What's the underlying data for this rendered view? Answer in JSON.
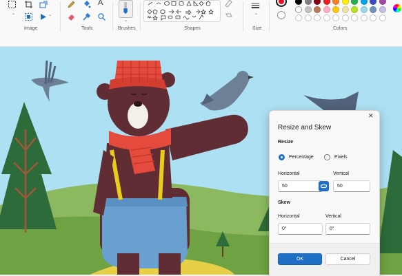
{
  "ribbon": {
    "groups": {
      "image": "Image",
      "tools": "Tools",
      "brushes": "Brushes",
      "shapes": "Shapes",
      "size": "Size",
      "colors": "Colors"
    },
    "tool_letter": "A",
    "palette_row1": [
      "#000000",
      "#7f7f7f",
      "#880015",
      "#ed1c24",
      "#ff7f27",
      "#fff200",
      "#22b14c",
      "#00a2e8",
      "#3f48cc",
      "#a349a4"
    ],
    "palette_row2": [
      "#ffffff",
      "#c3c3c3",
      "#b97a57",
      "#ffaec9",
      "#ffc90e",
      "#efe4b0",
      "#b5e61d",
      "#99d9ea",
      "#7092be",
      "#c8bfe7"
    ],
    "active_color": "#e81123"
  },
  "dialog": {
    "title": "Resize and Skew",
    "close_icon": "close-icon",
    "resize": {
      "heading": "Resize",
      "option_percentage": "Percentage",
      "option_pixels": "Pixels",
      "selected": "Percentage",
      "horizontal_label": "Horizontal",
      "horizontal_value": "50",
      "vertical_label": "Vertical",
      "vertical_value": "50",
      "link_icon": "link-icon"
    },
    "skew": {
      "heading": "Skew",
      "horizontal_label": "Horizontal",
      "horizontal_value": "0°",
      "vertical_label": "Vertical",
      "vertical_value": "0°"
    },
    "ok_label": "OK",
    "cancel_label": "Cancel"
  }
}
